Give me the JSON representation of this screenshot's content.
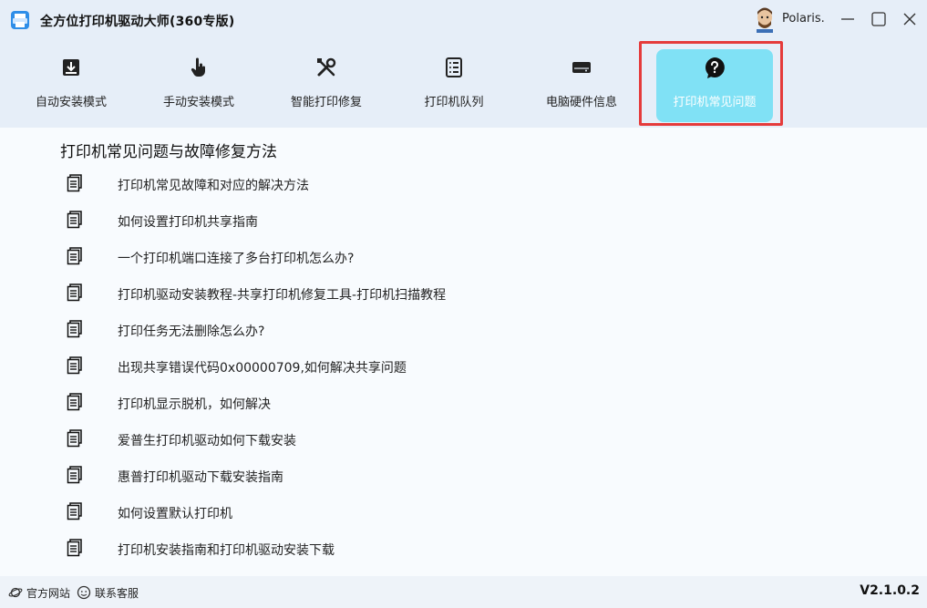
{
  "window": {
    "title": "全方位打印机驱动大师(360专版)",
    "username": "Polaris.",
    "buttons": [
      "minimize",
      "maximize",
      "close"
    ]
  },
  "toolbar": {
    "tabs": [
      {
        "label": "自动安装模式",
        "icon": "download-icon"
      },
      {
        "label": "手动安装模式",
        "icon": "hand-pointer-icon"
      },
      {
        "label": "智能打印修复",
        "icon": "wrench-screwdriver-icon"
      },
      {
        "label": "打印机队列",
        "icon": "list-icon"
      },
      {
        "label": "电脑硬件信息",
        "icon": "hard-drive-icon"
      },
      {
        "label": "打印机常见问题",
        "icon": "question-bubble-icon",
        "active": true
      }
    ]
  },
  "main": {
    "section_title": "打印机常见问题与故障修复方法",
    "items": [
      "打印机常见故障和对应的解决方法",
      "如何设置打印机共享指南",
      "一个打印机端口连接了多台打印机怎么办?",
      "打印机驱动安装教程-共享打印机修复工具-打印机扫描教程",
      "打印任务无法删除怎么办?",
      "出现共享错误代码0x00000709,如何解决共享问题",
      "打印机显示脱机，如何解决",
      "爱普生打印机驱动如何下载安装",
      "惠普打印机驱动下载安装指南",
      "如何设置默认打印机",
      "打印机安装指南和打印机驱动安装下载"
    ]
  },
  "status": {
    "official_site": "官方网站",
    "support": "联系客服",
    "version": "V2.1.0.2"
  },
  "colors": {
    "active_tab": "#80e1f5",
    "highlight_border": "#e53b3b",
    "header_bg": "#e6eef8"
  }
}
